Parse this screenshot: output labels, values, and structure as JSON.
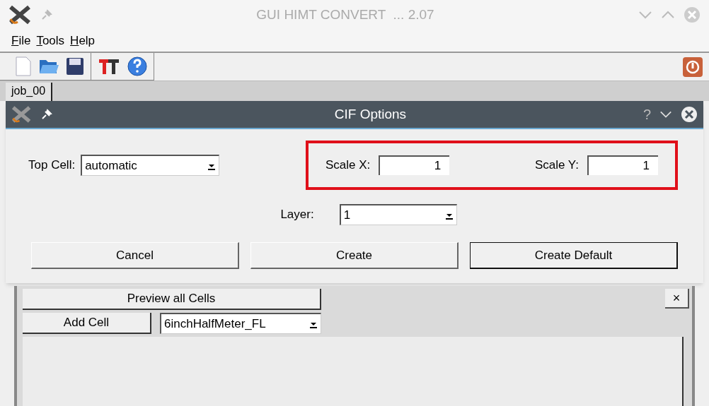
{
  "window": {
    "title": "GUI HIMT CONVERT  ... 2.07"
  },
  "menu": [
    "File",
    "Tools",
    "Help"
  ],
  "tabs": [
    {
      "label": "job_00",
      "selected": true
    }
  ],
  "dialog": {
    "title": "CIF Options",
    "help": "?",
    "top_cell": {
      "label": "Top Cell:",
      "value": "automatic"
    },
    "scale_x": {
      "label": "Scale X:",
      "value": "1"
    },
    "scale_y": {
      "label": "Scale Y:",
      "value": "1"
    },
    "layer": {
      "label": "Layer:",
      "value": "1"
    },
    "buttons": [
      {
        "label": "Cancel",
        "selected": false
      },
      {
        "label": "Create",
        "selected": false
      },
      {
        "label": "Create Default",
        "selected": true
      }
    ]
  },
  "panel": {
    "preview_button": "Preview all Cells",
    "add_button": "Add Cell",
    "cell_select": "6inchHalfMeter_FL",
    "close": "×"
  }
}
